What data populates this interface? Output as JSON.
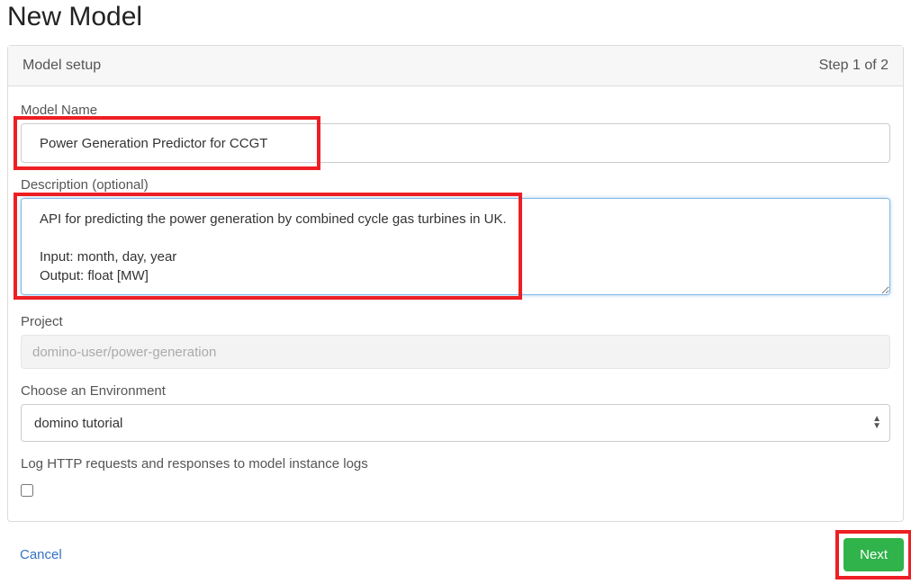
{
  "page_title": "New Model",
  "panel": {
    "title": "Model setup",
    "step_indicator": "Step 1 of 2"
  },
  "form": {
    "model_name": {
      "label": "Model Name",
      "value": "Power Generation Predictor for CCGT"
    },
    "description": {
      "label": "Description (optional)",
      "value": "API for predicting the power generation by combined cycle gas turbines in UK.\n\nInput: month, day, year\nOutput: float [MW]"
    },
    "project": {
      "label": "Project",
      "value": "domino-user/power-generation"
    },
    "environment": {
      "label": "Choose an Environment",
      "selected": "domino tutorial"
    },
    "log_http": {
      "label": "Log HTTP requests and responses to model instance logs",
      "checked": false
    }
  },
  "footer": {
    "cancel_label": "Cancel",
    "next_label": "Next"
  }
}
